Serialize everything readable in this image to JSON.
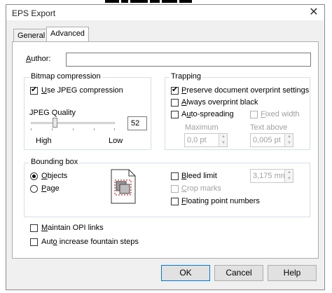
{
  "window": {
    "title": "EPS Export",
    "close_glyph": "✕"
  },
  "tabs": [
    {
      "label": "General"
    },
    {
      "label": "Advanced"
    }
  ],
  "author": {
    "label": "Author:",
    "value": ""
  },
  "bitmap": {
    "legend": "Bitmap compression",
    "jpeg_label": "Use JPEG compression",
    "jpeg_checked": true,
    "quality_label": "JPEG Quality",
    "quality_value": "52",
    "high_label": "High",
    "low_label": "Low"
  },
  "trapping": {
    "legend": "Trapping",
    "preserve_label": "Preserve document overprint settings",
    "preserve_checked": true,
    "always_label": "Always overprint black",
    "auto_label": "Auto-spreading",
    "fixed_label": "Fixed width",
    "maximum_label": "Maximum",
    "maximum_value": "0,0 pt",
    "text_above_label": "Text above",
    "text_above_value": "0,005 pt"
  },
  "bounding": {
    "legend": "Bounding box",
    "objects_label": "Objects",
    "page_label": "Page",
    "bleed_label": "Bleed limit",
    "bleed_value": "3,175 mm",
    "crop_label": "Crop marks",
    "floating_label": "Floating point numbers"
  },
  "options": {
    "opi_label": "Maintain OPI links",
    "fountain_label": "Auto increase fountain steps"
  },
  "buttons": {
    "ok": "OK",
    "cancel": "Cancel",
    "help": "Help"
  }
}
